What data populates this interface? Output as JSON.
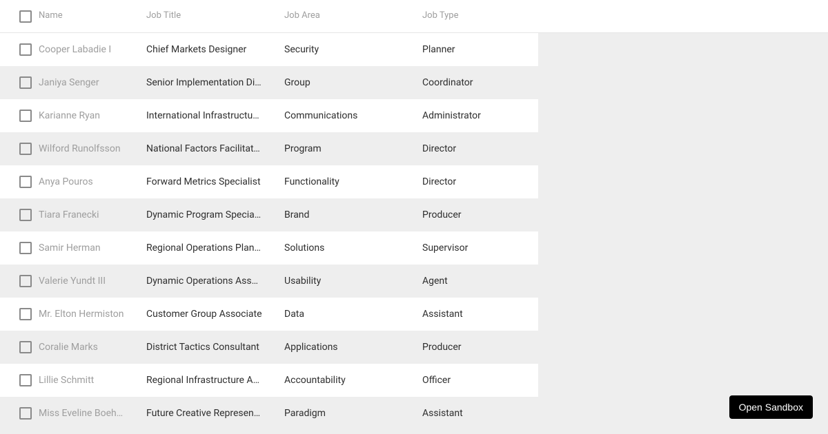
{
  "table": {
    "columns": {
      "name": "Name",
      "title": "Job Title",
      "area": "Job Area",
      "type": "Job Type"
    },
    "rows": [
      {
        "name": "Cooper Labadie I",
        "title": "Chief Markets Designer",
        "area": "Security",
        "type": "Planner"
      },
      {
        "name": "Janiya Senger",
        "title": "Senior Implementation Director",
        "area": "Group",
        "type": "Coordinator"
      },
      {
        "name": "Karianne Ryan",
        "title": "International Infrastructure Agent",
        "area": "Communications",
        "type": "Administrator"
      },
      {
        "name": "Wilford Runolfsson",
        "title": "National Factors Facilitator",
        "area": "Program",
        "type": "Director"
      },
      {
        "name": "Anya Pouros",
        "title": "Forward Metrics Specialist",
        "area": "Functionality",
        "type": "Director"
      },
      {
        "name": "Tiara Franecki",
        "title": "Dynamic Program Specialist",
        "area": "Brand",
        "type": "Producer"
      },
      {
        "name": "Samir Herman",
        "title": "Regional Operations Planner",
        "area": "Solutions",
        "type": "Supervisor"
      },
      {
        "name": "Valerie Yundt III",
        "title": "Dynamic Operations Associate",
        "area": "Usability",
        "type": "Agent"
      },
      {
        "name": "Mr. Elton Hermiston",
        "title": "Customer Group Associate",
        "area": "Data",
        "type": "Assistant"
      },
      {
        "name": "Coralie Marks",
        "title": "District Tactics Consultant",
        "area": "Applications",
        "type": "Producer"
      },
      {
        "name": "Lillie Schmitt",
        "title": "Regional Infrastructure Analyst",
        "area": "Accountability",
        "type": "Officer"
      },
      {
        "name": "Miss Eveline Boehm",
        "title": "Future Creative Representative",
        "area": "Paradigm",
        "type": "Assistant"
      }
    ]
  },
  "actions": {
    "open_sandbox_label": "Open Sandbox"
  }
}
